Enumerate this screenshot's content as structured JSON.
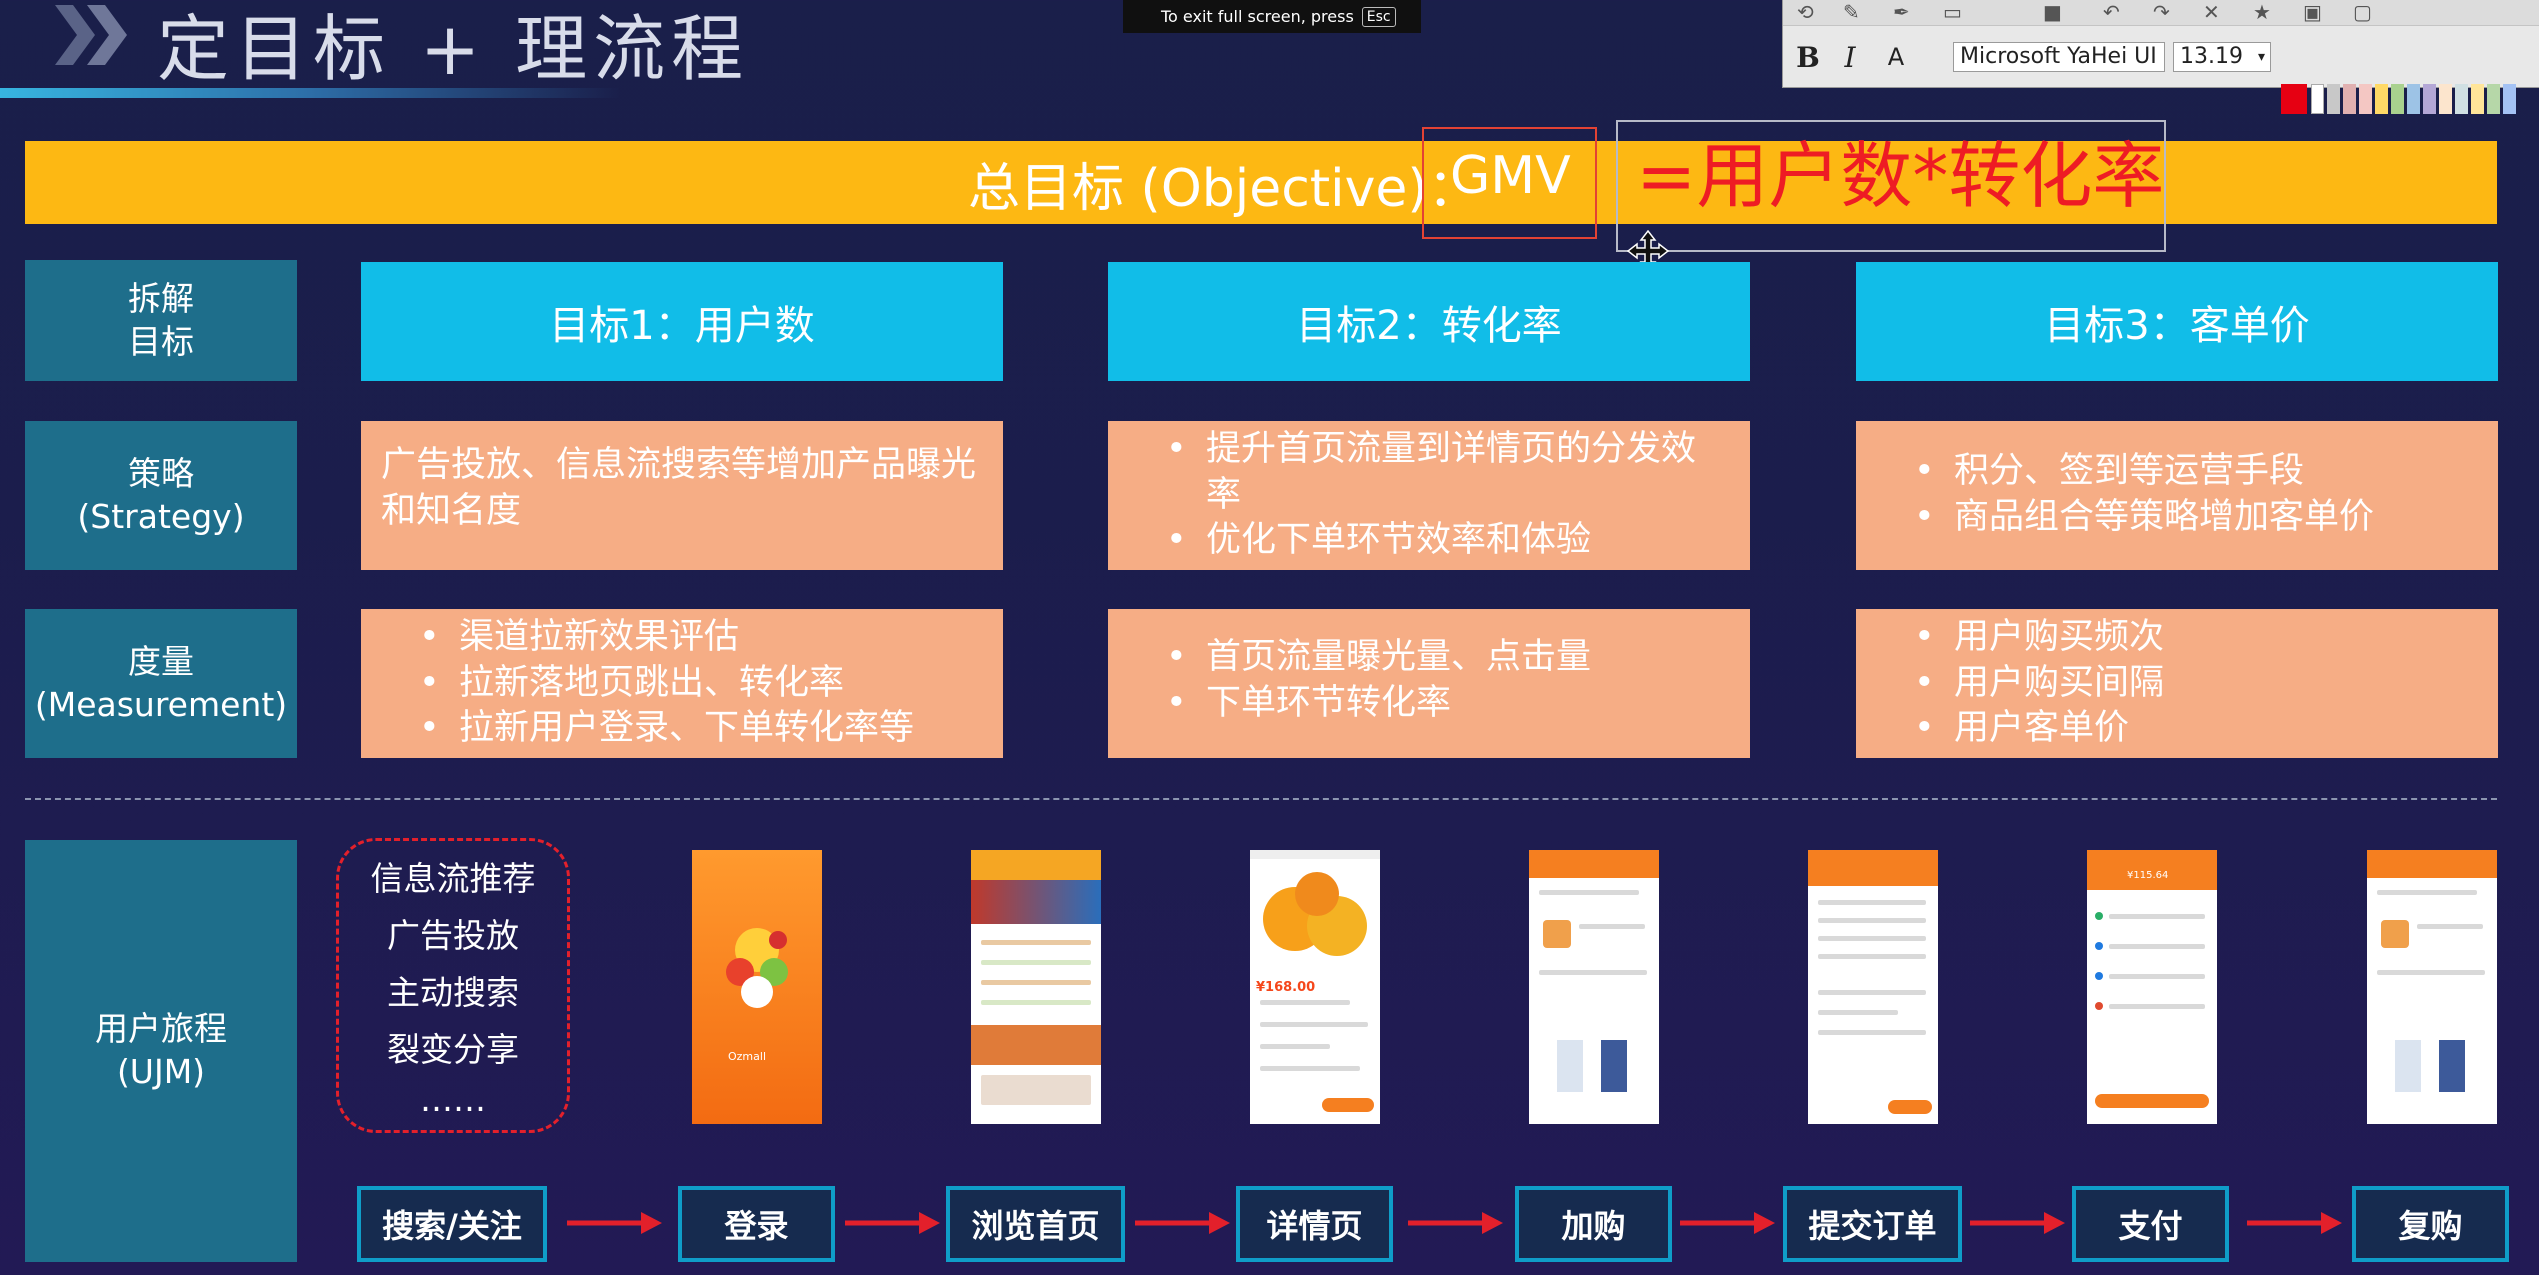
{
  "header": {
    "title": "定目标 + 理流程"
  },
  "fullscreen_hint": {
    "text": "To exit full screen, press",
    "key": "Esc"
  },
  "toolbar": {
    "bold": "B",
    "italic": "I",
    "highlight": "A",
    "font_name": "Microsoft YaHei UI",
    "font_size": "13.19",
    "swatch_colors": [
      "#e60012",
      "#f0f0f0",
      "#c8c8c8",
      "#e0b0b0",
      "#f4c7c3",
      "#ffd966",
      "#a9d18e",
      "#9dc3e6",
      "#b4a7d6",
      "#ffffff",
      "#e8e8e8",
      "#d0e0e3",
      "#fce5cd"
    ]
  },
  "objective": {
    "label": "总目标 (Objective)：",
    "metric": "GMV",
    "formula": "=用户数*转化率"
  },
  "rows": {
    "decompose": [
      "拆解",
      "目标"
    ],
    "strategy": [
      "策略",
      "(Strategy)"
    ],
    "measurement": [
      "度量",
      "(Measurement)"
    ],
    "journey": [
      "用户旅程",
      "(UJM)"
    ]
  },
  "goals": [
    {
      "title": "目标1：用户数",
      "strategy_text": "广告投放、信息流搜索等增加产品曝光和知名度",
      "measurements": [
        "渠道拉新效果评估",
        "拉新落地页跳出、转化率",
        "拉新用户登录、下单转化率等"
      ]
    },
    {
      "title": "目标2：转化率",
      "strategies": [
        "提升首页流量到详情页的分发效率",
        "优化下单环节效率和体验"
      ],
      "measurements": [
        "首页流量曝光量、点击量",
        "下单环节转化率"
      ]
    },
    {
      "title": "目标3：客单价",
      "strategies": [
        "积分、签到等运营手段",
        "商品组合等策略增加客单价"
      ],
      "measurements": [
        "用户购买频次",
        "用户购买间隔",
        "用户客单价"
      ]
    }
  ],
  "channels": [
    "信息流推荐",
    "广告投放",
    "主动搜索",
    "裂变分享",
    "……"
  ],
  "phones": {
    "splash_logo": "Ozmall",
    "price_detail": "¥168.00",
    "price_pay": "¥115.64"
  },
  "flow_steps": [
    "搜索/关注",
    "登录",
    "浏览首页",
    "详情页",
    "加购",
    "提交订单",
    "支付",
    "复购"
  ]
}
